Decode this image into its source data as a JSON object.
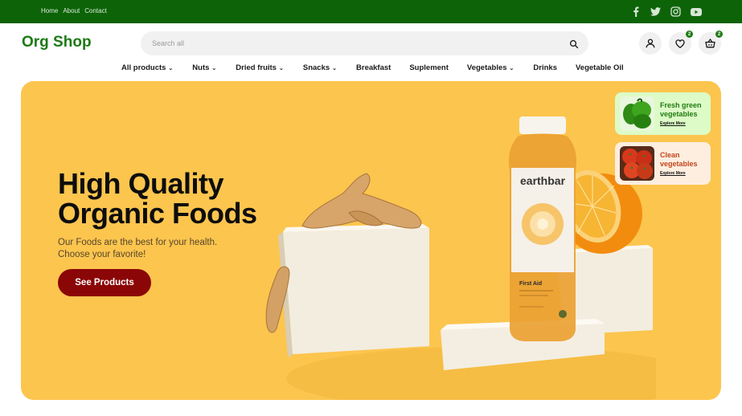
{
  "topbar": {
    "links": [
      "Home",
      "About",
      "Contact"
    ],
    "social": [
      "facebook-icon",
      "twitter-icon",
      "instagram-icon",
      "youtube-icon"
    ],
    "color": "#0d6408"
  },
  "header": {
    "logo": "Org Shop",
    "search_placeholder": "Search all",
    "wishlist_count": "2",
    "cart_count": "2"
  },
  "nav": {
    "items": [
      {
        "label": "All products",
        "dropdown": true
      },
      {
        "label": "Nuts",
        "dropdown": true
      },
      {
        "label": "Dried fruits",
        "dropdown": true
      },
      {
        "label": "Snacks",
        "dropdown": true
      },
      {
        "label": "Breakfast",
        "dropdown": false
      },
      {
        "label": "Suplement",
        "dropdown": false
      },
      {
        "label": "Vegetables",
        "dropdown": true
      },
      {
        "label": "Drinks",
        "dropdown": false
      },
      {
        "label": "Vegetable Oil",
        "dropdown": false
      }
    ]
  },
  "hero": {
    "title_line1": "High Quality",
    "title_line2": "Organic Foods",
    "subtitle_line1": "Our Foods are the best for your health.",
    "subtitle_line2": "Choose your favorite!",
    "cta": "See Products",
    "bottle_brand": "earthbar",
    "bottle_name": "First Aid",
    "background": "#fcc54e",
    "cta_color": "#8b0606"
  },
  "promos": [
    {
      "title_line1": "Fresh green",
      "title_line2": "vegetables",
      "link": "Explore More",
      "bg": "#dcfbc6",
      "color": "#1f7a12"
    },
    {
      "title_line1": "Clean",
      "title_line2": "vegetables",
      "link": "Explore More",
      "bg": "#fdeee0",
      "color": "#c4461c"
    }
  ]
}
